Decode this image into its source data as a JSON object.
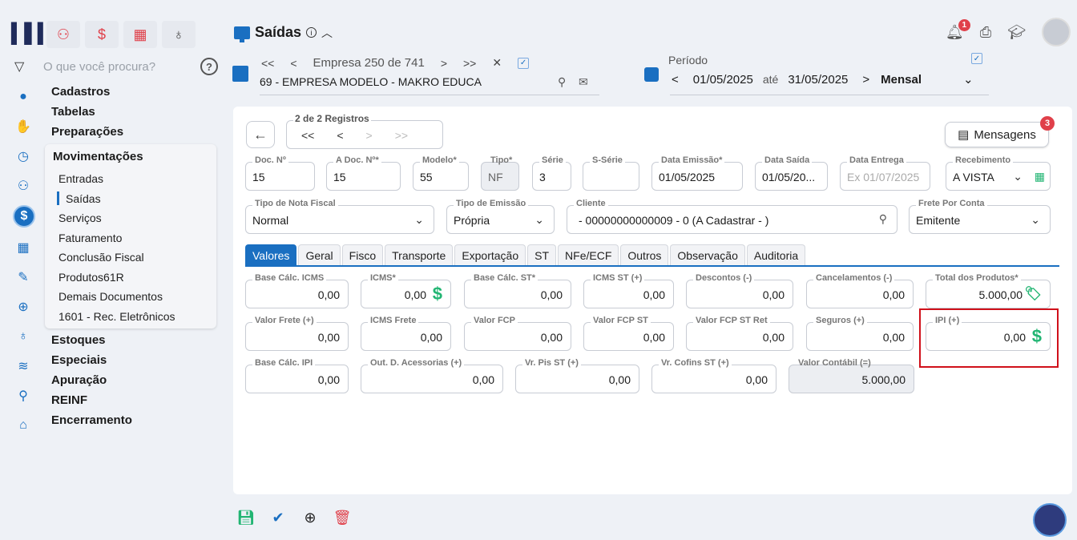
{
  "sidebar": {
    "search_placeholder": "O que você procura?",
    "menu_top": [
      "Cadastros",
      "Tabelas",
      "Preparações"
    ],
    "submenu_title": "Movimentações",
    "submenu_items": [
      "Entradas",
      "Saídas",
      "Serviços",
      "Faturamento",
      "Conclusão Fiscal",
      "Produtos61R",
      "Demais Documentos",
      "1601 - Rec. Eletrônicos"
    ],
    "selected_item": "Saídas",
    "menu_bottom": [
      "Estoques",
      "Especiais",
      "Apuração",
      "REINF",
      "Encerramento"
    ]
  },
  "header": {
    "title": "Saídas",
    "empresa_label": "Empresa 250 de 741",
    "empresa_name": "69 - EMPRESA MODELO - MAKRO EDUCA",
    "periodo_label": "Período",
    "date_from": "01/05/2025",
    "ate": "até",
    "date_to": "31/05/2025",
    "period_type": "Mensal",
    "notification_count": "1"
  },
  "card": {
    "registros_label": "2 de 2 Registros",
    "mensagens_label": "Mensagens",
    "mensagens_count": "3",
    "fields": {
      "doc_no": {
        "label": "Doc. Nº",
        "value": "15"
      },
      "a_doc_no": {
        "label": "A Doc. Nº*",
        "value": "15"
      },
      "modelo": {
        "label": "Modelo*",
        "value": "55"
      },
      "tipo": {
        "label": "Tipo*",
        "value": "NF"
      },
      "serie": {
        "label": "Série",
        "value": "3"
      },
      "s_serie": {
        "label": "S-Série",
        "value": ""
      },
      "data_emissao": {
        "label": "Data Emissão*",
        "value": "01/05/2025"
      },
      "data_saida": {
        "label": "Data Saída",
        "value": "01/05/20..."
      },
      "data_entrega": {
        "label": "Data Entrega",
        "placeholder": "Ex 01/07/2025"
      },
      "recebimento": {
        "label": "Recebimento",
        "value": "A VISTA"
      },
      "tipo_nota": {
        "label": "Tipo de Nota Fiscal",
        "value": "Normal"
      },
      "tipo_emissao": {
        "label": "Tipo de Emissão",
        "value": "Própria"
      },
      "cliente": {
        "label": "Cliente",
        "value": "- 00000000000009 - 0 (A Cadastrar -   )"
      },
      "frete": {
        "label": "Frete Por Conta",
        "value": "Emitente"
      }
    },
    "tabs": [
      "Valores",
      "Geral",
      "Fisco",
      "Transporte",
      "Exportação",
      "ST",
      "NFe/ECF",
      "Outros",
      "Observação",
      "Auditoria"
    ],
    "active_tab": "Valores",
    "valores": {
      "base_calc_icms": {
        "label": "Base Cálc. ICMS",
        "value": "0,00"
      },
      "icms": {
        "label": "ICMS*",
        "value": "0,00"
      },
      "base_calc_st": {
        "label": "Base Cálc. ST*",
        "value": "0,00"
      },
      "icms_st": {
        "label": "ICMS ST (+)",
        "value": "0,00"
      },
      "descontos": {
        "label": "Descontos (-)",
        "value": "0,00"
      },
      "cancelamentos": {
        "label": "Cancelamentos (-)",
        "value": "0,00"
      },
      "total_produtos": {
        "label": "Total dos Produtos*",
        "value": "5.000,00"
      },
      "valor_frete": {
        "label": "Valor Frete (+)",
        "value": "0,00"
      },
      "icms_frete": {
        "label": "ICMS Frete",
        "value": "0,00"
      },
      "valor_fcp": {
        "label": "Valor FCP",
        "value": "0,00"
      },
      "valor_fcp_st": {
        "label": "Valor FCP ST",
        "value": "0,00"
      },
      "valor_fcp_st_ret": {
        "label": "Valor FCP ST Ret",
        "value": "0,00"
      },
      "seguros": {
        "label": "Seguros (+)",
        "value": "0,00"
      },
      "ipi": {
        "label": "IPI (+)",
        "value": "0,00"
      },
      "base_calc_ipi": {
        "label": "Base Cálc. IPI",
        "value": "0,00"
      },
      "out_acessorias": {
        "label": "Out. D. Acessorias (+)",
        "value": "0,00"
      },
      "vr_pis_st": {
        "label": "Vr. Pis ST (+)",
        "value": "0,00"
      },
      "vr_cofins_st": {
        "label": "Vr. Cofins ST (+)",
        "value": "0,00"
      },
      "valor_contabil": {
        "label": "Valor Contábil (=)",
        "value": "5.000,00"
      }
    }
  },
  "colors": {
    "accent": "#1a6fc1",
    "money_green": "#22b573",
    "highlight": "#d0101a",
    "badge": "#e0404a"
  }
}
